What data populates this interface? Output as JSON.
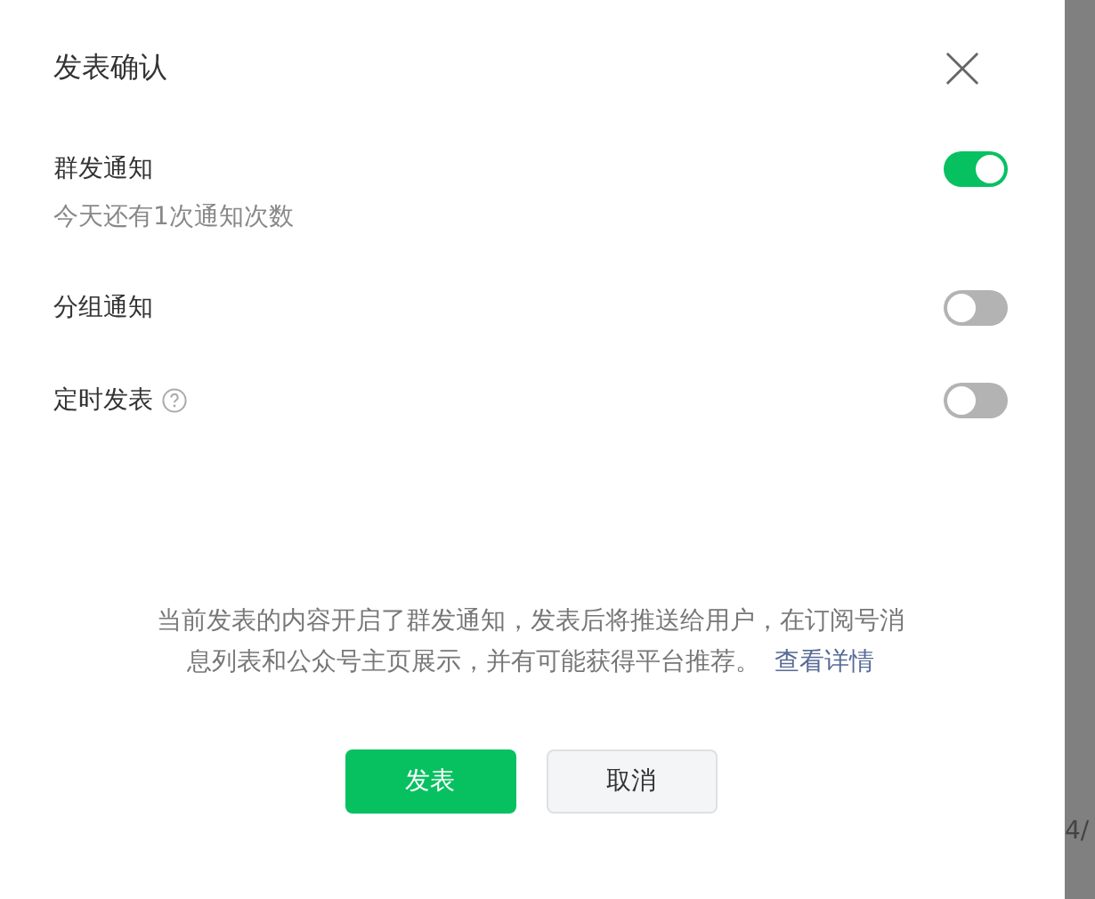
{
  "dialog": {
    "title": "发表确认"
  },
  "options": [
    {
      "label": "群发通知",
      "hint": "今天还有1次通知次数",
      "has_help": false,
      "on": true
    },
    {
      "label": "分组通知",
      "has_help": false,
      "on": false
    },
    {
      "label": "定时发表",
      "has_help": true,
      "on": false
    }
  ],
  "notice": {
    "text": "当前发表的内容开启了群发通知，发表后将推送给用户，在订阅号消息列表和公众号主页展示，并有可能获得平台推荐。",
    "link": "查看详情"
  },
  "buttons": [
    {
      "label": "发表",
      "kind": "primary"
    },
    {
      "label": "取消",
      "kind": "secondary"
    }
  ],
  "background": {
    "page_text": "4/"
  }
}
